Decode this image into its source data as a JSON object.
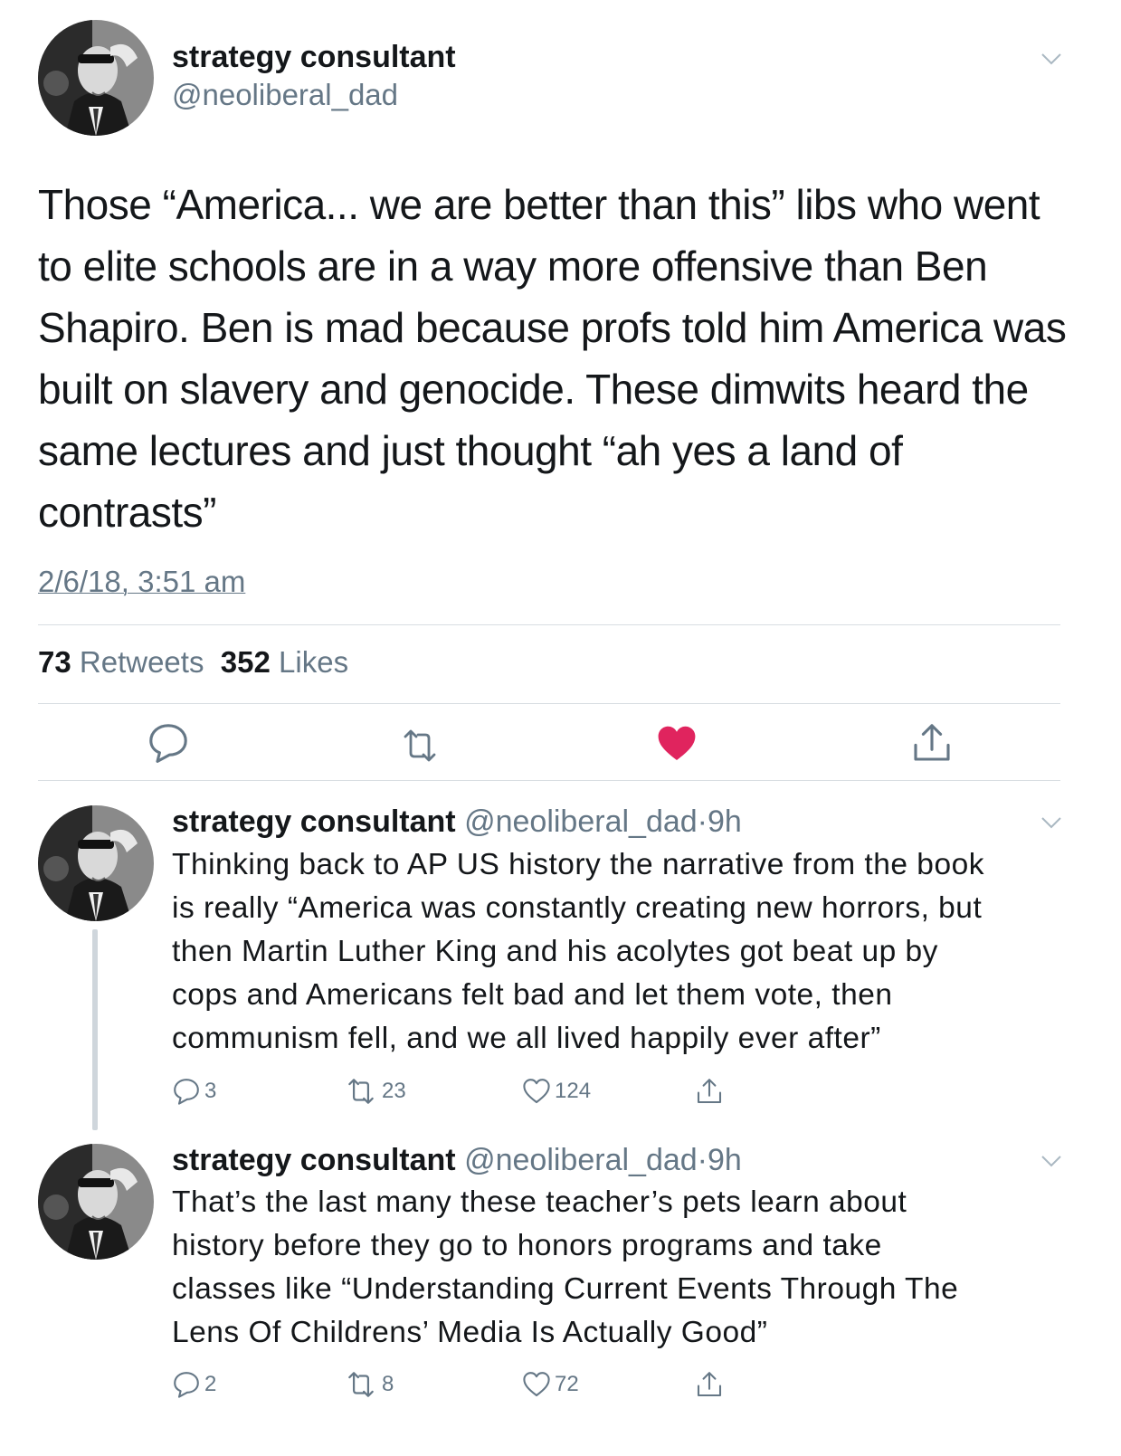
{
  "main_tweet": {
    "display_name": "strategy consultant",
    "handle": "@neoliberal_dad",
    "text": "Those “America... we are better than this” libs who went\nto elite schools are in a way more offensive than Ben\nShapiro. Ben is mad because profs told him America was\nbuilt on slavery and genocide. These dimwits heard the\nsame lectures and just thought “ah yes a land of\ncontrasts”",
    "timestamp": "2/6/18, 3:51 am",
    "retweets_count": "73",
    "retweets_label": "Retweets",
    "likes_count": "352",
    "likes_label": "Likes",
    "liked": true
  },
  "replies": [
    {
      "display_name": "strategy consultant",
      "handle": "@neoliberal_dad",
      "time": "9h",
      "separator": "·",
      "text": "Thinking back to AP US history the narrative from the book\nis really “America was constantly creating new horrors, but\nthen Martin Luther King and his acolytes got beat up by\ncops and Americans felt bad and let them vote, then\ncommunism fell, and we all lived happily ever after”",
      "replies_count": "3",
      "retweets_count": "23",
      "likes_count": "124"
    },
    {
      "display_name": "strategy consultant",
      "handle": "@neoliberal_dad",
      "time": "9h",
      "separator": "·",
      "text": "That’s the last many these teacher’s pets learn about\nhistory before they go to honors programs and take\nclasses like “Understanding Current Events Through The\nLens Of Childrens’ Media Is Actually Good”",
      "replies_count": "2",
      "retweets_count": "8",
      "likes_count": "72"
    }
  ],
  "colors": {
    "text": "#14171a",
    "muted": "#657786",
    "like_red": "#e0245e",
    "divider": "#d8dde2",
    "thread_line": "#cfd6dc"
  },
  "icons": [
    "chevron-down-icon",
    "reply-icon",
    "retweet-icon",
    "heart-icon",
    "share-icon",
    "avatar"
  ]
}
